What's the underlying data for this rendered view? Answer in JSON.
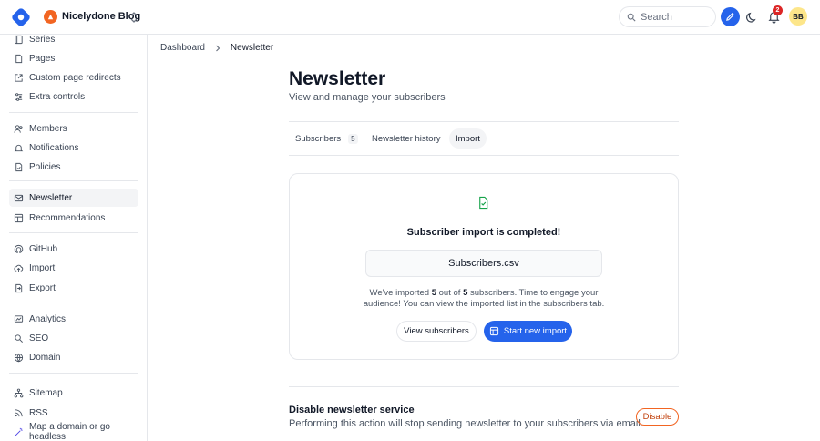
{
  "header": {
    "blog_name": "Nicelydone Blog",
    "search_placeholder": "Search",
    "notification_count": "2",
    "avatar_initials": "BB"
  },
  "sidebar": {
    "items": [
      {
        "label": "Series",
        "icon": "book-icon"
      },
      {
        "label": "Pages",
        "icon": "file-icon"
      },
      {
        "label": "Custom page redirects",
        "icon": "external-link-icon"
      },
      {
        "label": "Extra controls",
        "icon": "sliders-icon"
      },
      {
        "label": "Members",
        "icon": "users-icon"
      },
      {
        "label": "Notifications",
        "icon": "bell-icon"
      },
      {
        "label": "Policies",
        "icon": "document-check-icon"
      },
      {
        "label": "Newsletter",
        "icon": "mail-icon"
      },
      {
        "label": "Recommendations",
        "icon": "layout-icon"
      },
      {
        "label": "GitHub",
        "icon": "github-icon"
      },
      {
        "label": "Import",
        "icon": "cloud-upload-icon"
      },
      {
        "label": "Export",
        "icon": "file-export-icon"
      },
      {
        "label": "Analytics",
        "icon": "chart-icon"
      },
      {
        "label": "SEO",
        "icon": "search-icon"
      },
      {
        "label": "Domain",
        "icon": "globe-icon"
      },
      {
        "label": "Sitemap",
        "icon": "sitemap-icon"
      },
      {
        "label": "RSS",
        "icon": "rss-icon"
      },
      {
        "label": "Map a domain or go headless",
        "icon": "magic-wand-icon"
      }
    ],
    "active": "Newsletter"
  },
  "breadcrumb": {
    "root": "Dashboard",
    "current": "Newsletter"
  },
  "page": {
    "title": "Newsletter",
    "subtitle": "View and manage your subscribers"
  },
  "tabs": [
    {
      "label": "Subscribers",
      "count": "5"
    },
    {
      "label": "Newsletter history"
    },
    {
      "label": "Import"
    }
  ],
  "import_card": {
    "title": "Subscriber import is completed!",
    "file_name": "Subscribers.csv",
    "msg_part1": "We've imported ",
    "imported": "5",
    "msg_part2": " out of ",
    "total": "5",
    "msg_part3": " subscribers. Time to engage your",
    "msg_line2": "audience! You can view the imported list in the subscribers tab.",
    "view_button": "View subscribers",
    "new_import_button": "Start new import"
  },
  "danger": {
    "title": "Disable newsletter service",
    "description": "Performing this action will stop sending newsletter to your subscribers via email.",
    "button": "Disable"
  },
  "colors": {
    "accent": "#2563eb",
    "brand": "#f26522",
    "success": "#16a34a",
    "danger_badge": "#dc2626"
  }
}
